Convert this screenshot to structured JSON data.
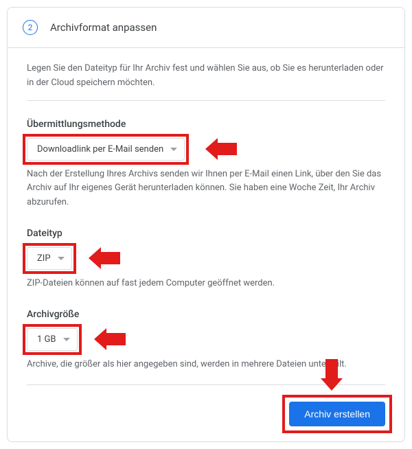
{
  "header": {
    "step_number": "2",
    "title": "Archivformat anpassen"
  },
  "intro": "Legen Sie den Dateityp für Ihr Archiv fest und wählen Sie aus, ob Sie es herunterladen oder in der Cloud speichern möchten.",
  "delivery": {
    "label": "Übermittlungsmethode",
    "selected": "Downloadlink per E-Mail senden",
    "help": "Nach der Erstellung Ihres Archivs senden wir Ihnen per E-Mail einen Link, über den Sie das Archiv auf Ihr eigenes Gerät herunterladen können. Sie haben eine Woche Zeit, Ihr Archiv abzurufen."
  },
  "filetype": {
    "label": "Dateityp",
    "selected": "ZIP",
    "help": "ZIP-Dateien können auf fast jedem Computer geöffnet werden."
  },
  "archivesize": {
    "label": "Archivgröße",
    "selected": "1 GB",
    "help": "Archive, die größer als hier angegeben sind, werden in mehrere Dateien unterteilt."
  },
  "footer": {
    "create_label": "Archiv erstellen"
  }
}
